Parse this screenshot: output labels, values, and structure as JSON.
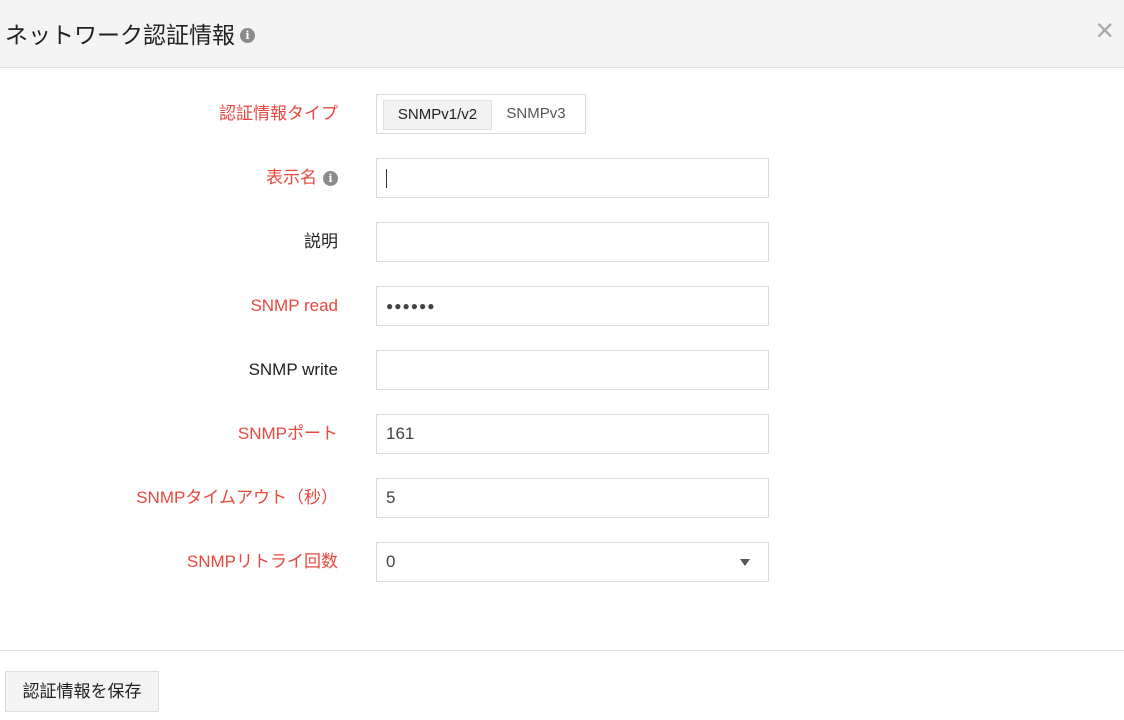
{
  "header": {
    "title": "ネットワーク認証情報",
    "close": "×"
  },
  "form": {
    "credential_type": {
      "label": "認証情報タイプ",
      "options": [
        "SNMPv1/v2",
        "SNMPv3"
      ],
      "selected": "SNMPv1/v2"
    },
    "display_name": {
      "label": "表示名",
      "value": ""
    },
    "description": {
      "label": "説明",
      "value": ""
    },
    "snmp_read": {
      "label": "SNMP read",
      "value": "●●●●●●"
    },
    "snmp_write": {
      "label": "SNMP write",
      "value": ""
    },
    "snmp_port": {
      "label": "SNMPポート",
      "value": "161"
    },
    "snmp_timeout": {
      "label": "SNMPタイムアウト（秒）",
      "value": "5"
    },
    "snmp_retries": {
      "label": "SNMPリトライ回数",
      "value": "0"
    }
  },
  "footer": {
    "save_label": "認証情報を保存"
  },
  "colors": {
    "required_label": "#e8473e",
    "header_bg": "#f4f4f4"
  }
}
